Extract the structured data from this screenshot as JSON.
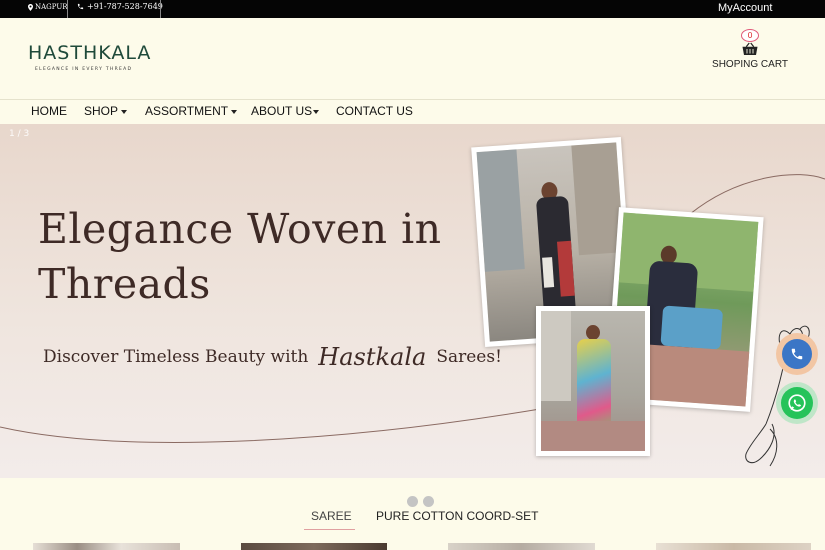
{
  "topbar": {
    "location": "NAGPUR",
    "phone": "+91-787-528-7649",
    "account": "MyAccount"
  },
  "header": {
    "logo": "HASTHKALA",
    "tagline": "ELEGANCE IN EVERY THREAD",
    "cart_count": "0",
    "cart_label": "SHOPING CART"
  },
  "nav": {
    "items": [
      "HOME",
      "SHOP",
      "ASSORTMENT",
      "ABOUT US",
      "CONTACT US"
    ]
  },
  "banner": {
    "counter": "1 / 3",
    "title_line1": "Elegance Woven in",
    "title_line2": "Threads",
    "sub_before": "Discover Timeless Beauty with",
    "sub_brand": "Hastkala",
    "sub_after": "Sarees!"
  },
  "tabs": [
    "SAREE",
    "PURE COTTON COORD-SET"
  ],
  "colors": {
    "topbar": "#050505",
    "header_bg": "#fdfbea",
    "logo": "#1f4a3a",
    "banner_text": "#3e2a26",
    "call": "#3b76c6",
    "whatsapp": "#25c35a"
  },
  "icons": {
    "location": "map-pin-icon",
    "phone": "phone-icon",
    "cart": "shopping-basket-icon",
    "call_button": "phone-icon",
    "whatsapp_button": "whatsapp-icon"
  }
}
